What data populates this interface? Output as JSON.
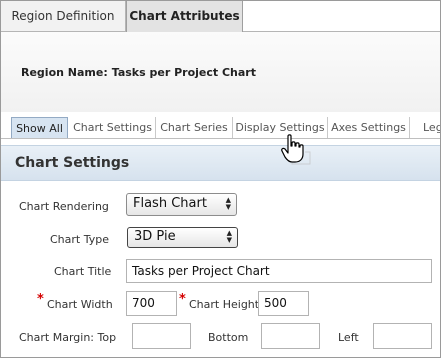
{
  "top_tabs": [
    "Region Definition",
    "Chart Attributes"
  ],
  "region": {
    "label": "Region Name:",
    "value": "Tasks per Project Chart"
  },
  "sub_tabs": [
    "Show All",
    "Chart Settings",
    "Chart Series",
    "Display Settings",
    "Axes Settings",
    "Leg"
  ],
  "section": {
    "title": "Chart Settings"
  },
  "form": {
    "rendering": {
      "label": "Chart Rendering",
      "value": "Flash Chart"
    },
    "type": {
      "label": "Chart Type",
      "value": "3D Pie"
    },
    "title": {
      "label": "Chart Title",
      "value": "Tasks per Project Chart"
    },
    "width": {
      "label": "Chart Width",
      "value": "700"
    },
    "height": {
      "label": "Chart Height",
      "value": "500"
    },
    "margin": {
      "label": "Chart Margin: Top",
      "bottom_label": "Bottom",
      "left_label": "Left",
      "top": "",
      "bottom": "",
      "left": ""
    }
  },
  "icons": {
    "required": "asterisk",
    "cursor": "hand-pointer-icon"
  },
  "colors": {
    "required": "#d40000",
    "active_subtab": "#d7e4f1",
    "section_header": "#dbe6f1"
  }
}
